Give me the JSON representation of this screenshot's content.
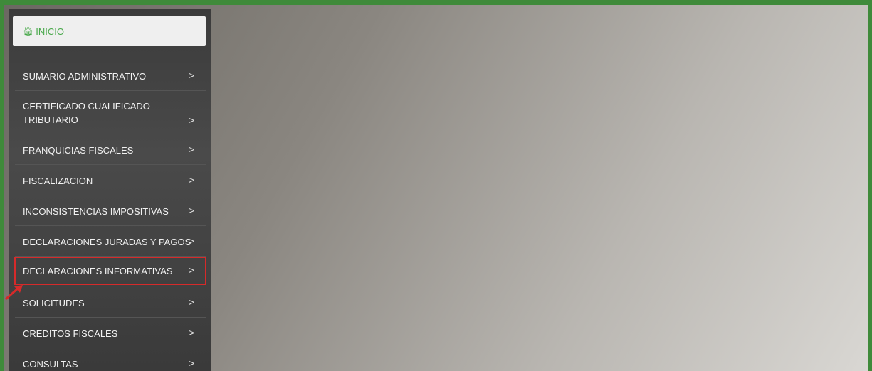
{
  "sidebar": {
    "home": {
      "icon": "home-icon",
      "label": "INICIO"
    },
    "items": [
      {
        "label": "SUMARIO ADMINISTRATIVO",
        "chevron": ">"
      },
      {
        "label": "CERTIFICADO CUALIFICADO\nTRIBUTARIO",
        "chevron": ">"
      },
      {
        "label": "FRANQUICIAS FISCALES",
        "chevron": ">"
      },
      {
        "label": "FISCALIZACION",
        "chevron": ">"
      },
      {
        "label": "INCONSISTENCIAS IMPOSITIVAS",
        "chevron": ">"
      },
      {
        "label": "DECLARACIONES JURADAS Y PAGOS",
        "chevron": ">"
      },
      {
        "label": "DECLARACIONES INFORMATIVAS",
        "chevron": ">",
        "highlighted": true
      },
      {
        "label": "SOLICITUDES",
        "chevron": ">"
      },
      {
        "label": "CREDITOS FISCALES",
        "chevron": ">"
      },
      {
        "label": "CONSULTAS",
        "chevron": ">"
      }
    ]
  },
  "colors": {
    "frame_border": "#3f8a3a",
    "home_text": "#48a84a",
    "highlight_outline": "#d62a2a"
  }
}
